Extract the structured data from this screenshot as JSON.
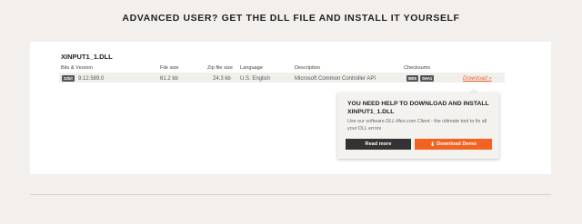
{
  "heading": "ADVANCED USER? GET THE DLL FILE AND INSTALL IT YOURSELF",
  "dll_name": "XINPUT1_1.DLL",
  "columns": {
    "bits_version": "Bits & Version",
    "file_size": "File size",
    "zip_size": "Zip file size",
    "language": "Language",
    "description": "Description",
    "checksums": "Checksums"
  },
  "row": {
    "bits": "32bit",
    "version": "9.12.589.0",
    "file_size": "61.2 kb",
    "zip_size": "24.3 kb",
    "language": "U.S. English",
    "description": "Microsoft Common Controller API",
    "md5": "MD5",
    "sha1": "SHA1",
    "download": "Download »"
  },
  "popup": {
    "title": "YOU NEED HELP TO DOWNLOAD AND INSTALL XINPUT1_1.DLL",
    "desc_before": "Use our software ",
    "desc_em": "DLL-files.com Client",
    "desc_after": " - the ultimate tool to fix all your DLL errors",
    "read_more": "Read more",
    "download_demo": "Download Demo"
  },
  "colors": {
    "accent": "#f26322",
    "dark_button": "#333333",
    "background": "#f2efec"
  },
  "icons": {
    "download": "download-icon"
  }
}
